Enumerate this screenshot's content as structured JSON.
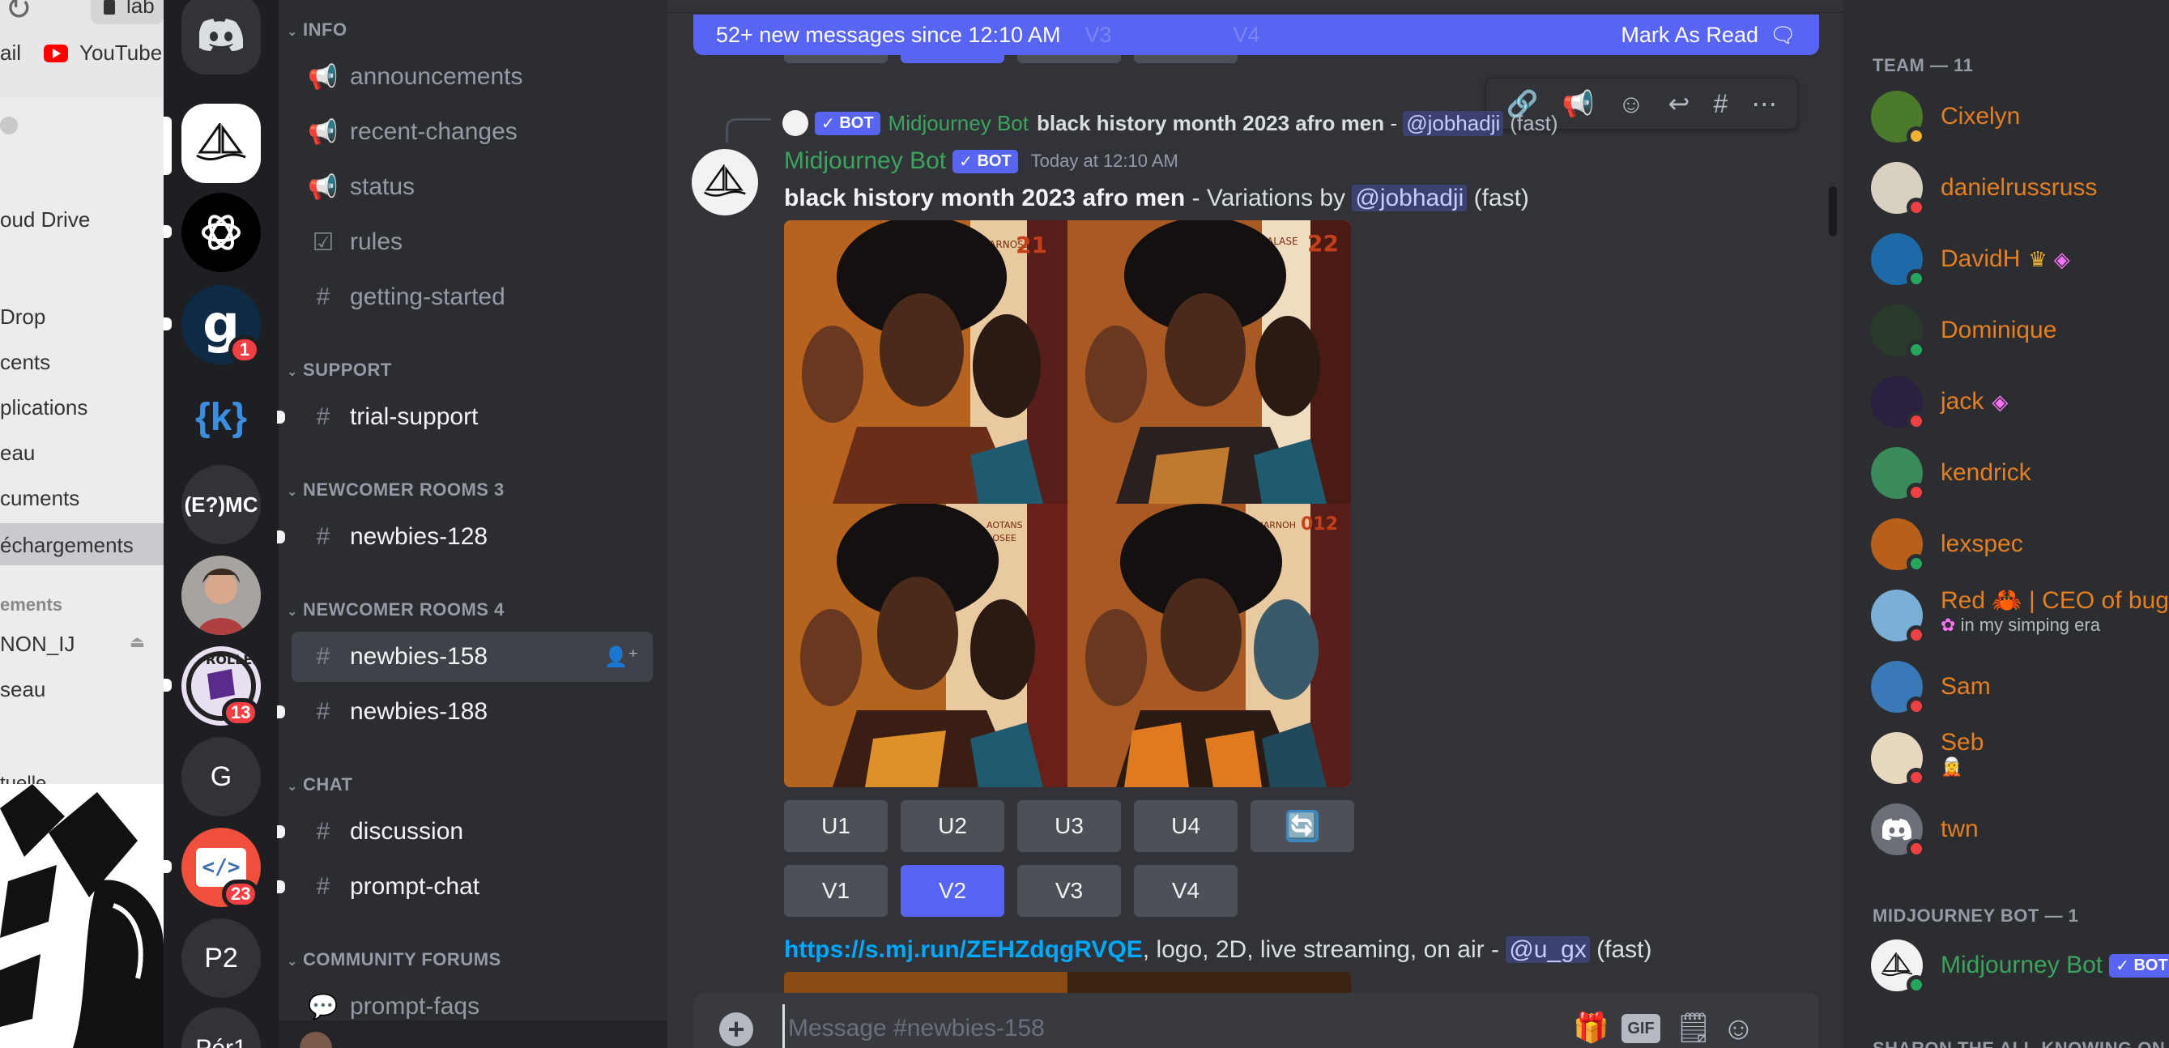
{
  "finder": {
    "tab_label": "lab",
    "youtube_label": "YouTube",
    "mail_label": "ail",
    "items": [
      "oud Drive",
      "Drop",
      "cents",
      "plications",
      "eau",
      "cuments",
      "échargements"
    ],
    "section": "ements",
    "sub_items": [
      "NON_IJ",
      "seau"
    ],
    "bottom_item": "tuelle"
  },
  "servers": [
    {
      "label": "",
      "icon": "discord-home"
    },
    {
      "label": "",
      "icon": "midjourney"
    },
    {
      "label": "",
      "icon": "openai"
    },
    {
      "label": "g",
      "badge": "1"
    },
    {
      "label": "{k}"
    },
    {
      "label": "(E?)MC"
    },
    {
      "label": "",
      "icon": "photo"
    },
    {
      "label": "",
      "badge": "13"
    },
    {
      "label": "G"
    },
    {
      "label": "</>",
      "badge": "23"
    },
    {
      "label": "P2"
    },
    {
      "label": "Pér1"
    }
  ],
  "channels": {
    "categories": [
      "INFO",
      "SUPPORT",
      "NEWCOMER ROOMS 3",
      "NEWCOMER ROOMS 4",
      "CHAT",
      "COMMUNITY FORUMS"
    ],
    "items": [
      {
        "name": "announcements",
        "icon": "megaphone"
      },
      {
        "name": "recent-changes",
        "icon": "megaphone"
      },
      {
        "name": "status",
        "icon": "megaphone"
      },
      {
        "name": "rules",
        "icon": "checkbox"
      },
      {
        "name": "getting-started",
        "icon": "hash"
      },
      {
        "name": "trial-support",
        "icon": "hash"
      },
      {
        "name": "newbies-128",
        "icon": "thread-hash"
      },
      {
        "name": "newbies-158",
        "icon": "thread-hash"
      },
      {
        "name": "newbies-188",
        "icon": "thread-hash"
      },
      {
        "name": "discussion",
        "icon": "hash"
      },
      {
        "name": "prompt-chat",
        "icon": "hash"
      },
      {
        "name": "prompt-faqs",
        "icon": "forum"
      }
    ]
  },
  "chat": {
    "new_messages": "52+ new messages since 12:10 AM",
    "mark_as_read": "Mark As Read",
    "ghost_buttons": [
      "V3",
      "V4"
    ],
    "reply": {
      "author": "Midjourney Bot",
      "badge": "BOT",
      "prompt": "black history month 2023 afro men",
      "sep": " - ",
      "mention": "@jobhadji",
      "speed": "(fast)"
    },
    "message": {
      "author": "Midjourney Bot",
      "badge": "BOT",
      "timestamp": "Today at 12:10 AM",
      "prompt": "black history month 2023 afro men",
      "variation_text": " - Variations by ",
      "mention": "@jobhadji",
      "speed": "(fast)"
    },
    "upscale_buttons": [
      "U1",
      "U2",
      "U3",
      "U4"
    ],
    "variation_buttons": [
      "V1",
      "V2",
      "V3",
      "V4"
    ],
    "next_message": {
      "link": "https://s.mj.run/ZEHZdqgRVQE",
      "text": ", logo, 2D, live streaming, on air - ",
      "mention": "@u_gx",
      "speed": "(fast)"
    },
    "composer_placeholder": "Message #newbies-158",
    "composer_gif": "GIF"
  },
  "members": {
    "team_header": "TEAM — 11",
    "team": [
      {
        "name": "Cixelyn",
        "status": "idle"
      },
      {
        "name": "danielrussruss",
        "status": "dnd"
      },
      {
        "name": "DavidH",
        "status": "online"
      },
      {
        "name": "Dominique",
        "status": "online"
      },
      {
        "name": "jack",
        "status": "dnd"
      },
      {
        "name": "kendrick",
        "status": "dnd"
      },
      {
        "name": "lexspec",
        "status": "online"
      },
      {
        "name": "Red 🦀 | CEO of bug",
        "status": "dnd",
        "sub": "in my simping era"
      },
      {
        "name": "Sam",
        "status": "dnd"
      },
      {
        "name": "Seb",
        "status": "dnd"
      },
      {
        "name": "twn",
        "status": "dnd"
      }
    ],
    "bot_header": "MIDJOURNEY BOT — 1",
    "bot": {
      "name": "Midjourney Bot",
      "badge": "BOT"
    },
    "next_header": "SHARON THE ALL-KNOWING ON"
  },
  "colors": {
    "blurple": "#5865f2",
    "bot_green": "#3ba55d",
    "member_orange": "#e67e22",
    "online": "#23a55a",
    "dnd": "#f23f43"
  }
}
